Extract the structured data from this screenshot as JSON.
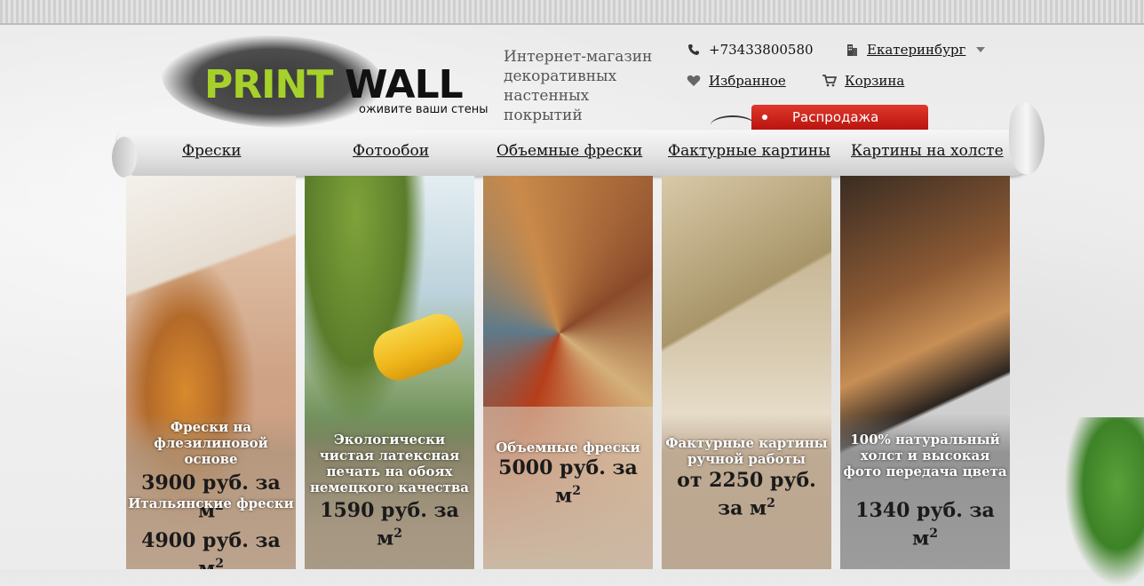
{
  "logo": {
    "print": "PRINT",
    "wall": "WALL",
    "slogan": "оживите ваши стены"
  },
  "tagline": "Интернет-магазин декоративных настенных покрытий",
  "contacts": {
    "phone": "+73433800580",
    "city": "Екатеринбург",
    "favorites": "Избранное",
    "cart": "Корзина"
  },
  "sale_label": "Распродажа",
  "nav": [
    "Фрески",
    "Фотообои",
    "Объемные фрески",
    "Фактурные картины",
    "Картины на холсте"
  ],
  "products": [
    {
      "caption": "Фрески на флезилиновой основе",
      "price": "3900 руб. за м",
      "caption2": "Итальянские фрески",
      "price2": "4900 руб. за м"
    },
    {
      "caption": "Экологически чистая латексная печать на обоях немецкого качества",
      "price": "1590 руб. за м"
    },
    {
      "caption": "Объемные фрески",
      "price": "5000 руб. за м"
    },
    {
      "caption": "Фактурные картины ручной работы",
      "price": "от 2250 руб. за м"
    },
    {
      "caption": "100% натуральный холст и высокая фото передача цвета",
      "price": "1340 руб. за м"
    }
  ],
  "unit_power": "2",
  "colors": {
    "logo_green": "#a6d12a",
    "sale_red": "#c9201a"
  }
}
